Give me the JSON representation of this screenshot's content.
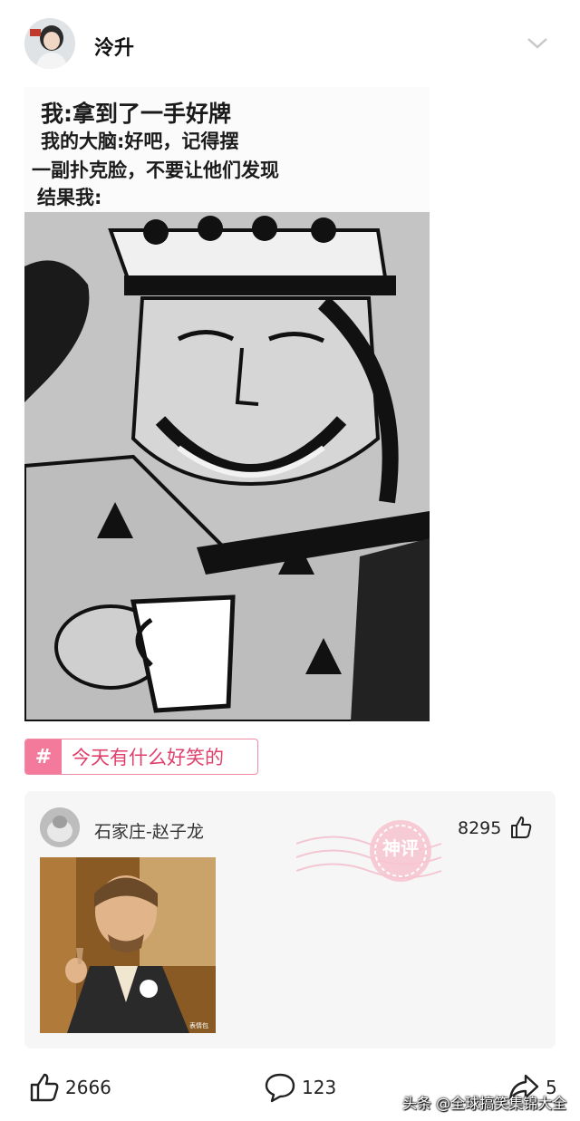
{
  "post": {
    "author": "泠升",
    "meme_lines": [
      "我:拿到了一手好牌",
      "我的大脑:好吧，记得摆",
      "一副扑克脸，不要让他们发现",
      "结果我:"
    ],
    "topic_tag": "今天有什么好笑的"
  },
  "top_comment": {
    "author": "石家庄-赵子龙",
    "likes": "8295",
    "badge_text": "神评",
    "image_mark": "表情包"
  },
  "actions": {
    "likes": "2666",
    "comments": "123",
    "shares": "5"
  },
  "watermark": "头条 @全球搞笑集锦大全",
  "colors": {
    "tag_accent": "#f37a9a",
    "tag_text": "#e03f6c",
    "card_bg": "#f6f6f7"
  }
}
